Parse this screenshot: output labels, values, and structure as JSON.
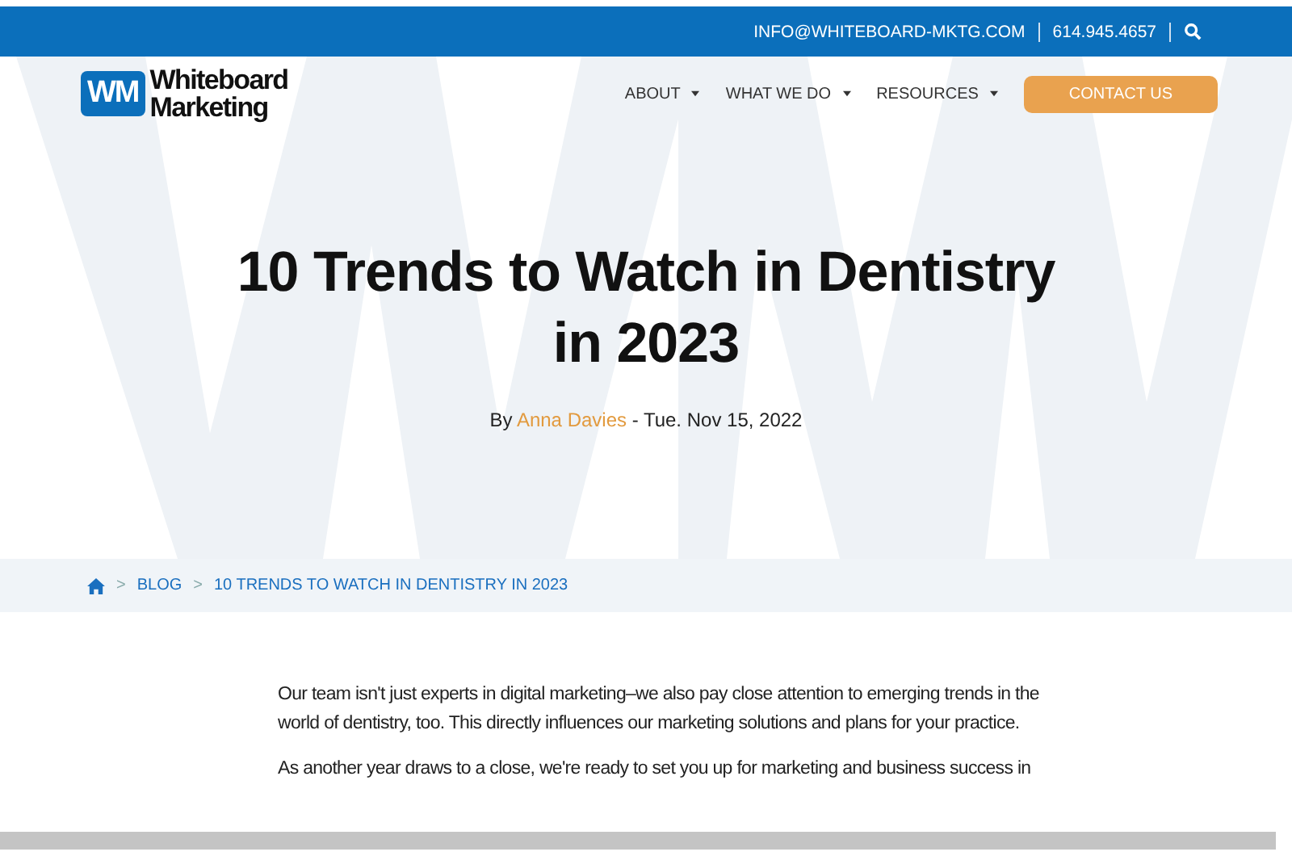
{
  "top_bar": {
    "email": "INFO@WHITEBOARD-MKTG.COM",
    "phone": "614.945.4657"
  },
  "logo": {
    "mark": "WM",
    "name_line_1": "Whiteboard",
    "name_line_2": "Marketing"
  },
  "nav": {
    "items": [
      {
        "label": "ABOUT",
        "dropdown": true
      },
      {
        "label": "WHAT WE DO",
        "dropdown": true
      },
      {
        "label": "RESOURCES",
        "dropdown": true
      }
    ],
    "cta": "CONTACT US"
  },
  "hero": {
    "title": "10 Trends to Watch in Dentistry in 2023",
    "byline_prefix": "By",
    "author": "Anna Davies",
    "date": "- Tue. Nov 15, 2022"
  },
  "breadcrumb": {
    "separator": ">",
    "items": [
      "BLOG",
      "10 TRENDS TO WATCH IN DENTISTRY IN 2023"
    ]
  },
  "article": {
    "paragraphs": [
      "Our team isn't just experts in digital marketing–we also pay close attention to emerging trends in the world of dentistry, too. This directly influences our marketing solutions and plans for your practice.",
      "As another year draws to a close, we're ready to set you up for marketing and business success in"
    ]
  }
}
